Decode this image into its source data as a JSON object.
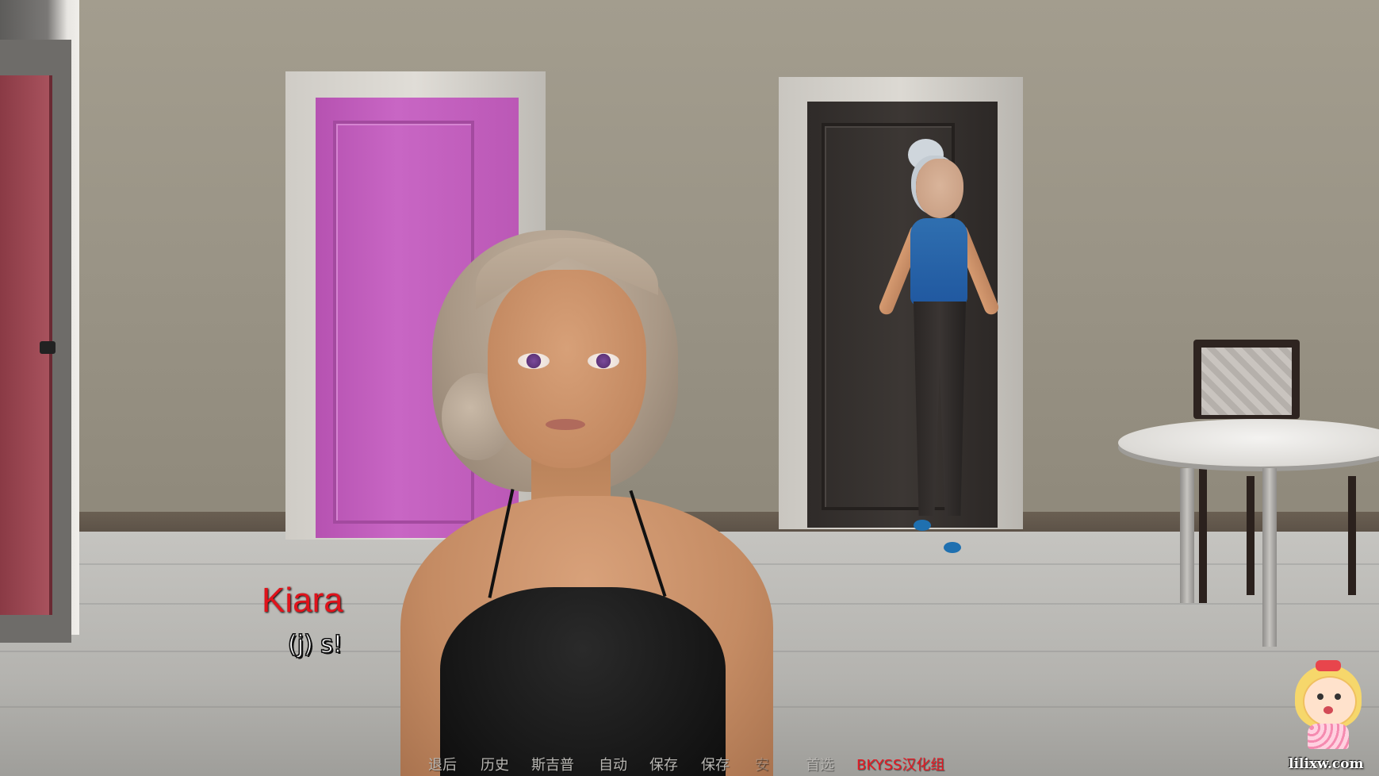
{
  "dialogue": {
    "speaker": "Kiara",
    "text": "(j) s!"
  },
  "quick_menu": {
    "items": [
      {
        "label": "退后"
      },
      {
        "label": "历史"
      },
      {
        "label": "斯吉普"
      },
      {
        "label": "自动"
      },
      {
        "label": "保存"
      },
      {
        "label": "保存"
      },
      {
        "label": "安"
      },
      {
        "label": "首选"
      }
    ],
    "credit": "BKYSS汉化组"
  },
  "watermark": {
    "text": "lilixw.com"
  },
  "colors": {
    "speaker_name": "#e0131b",
    "menu_text": "#b8b6b2",
    "credit_text": "#e61923",
    "dialogue_text": "#ffffff"
  }
}
